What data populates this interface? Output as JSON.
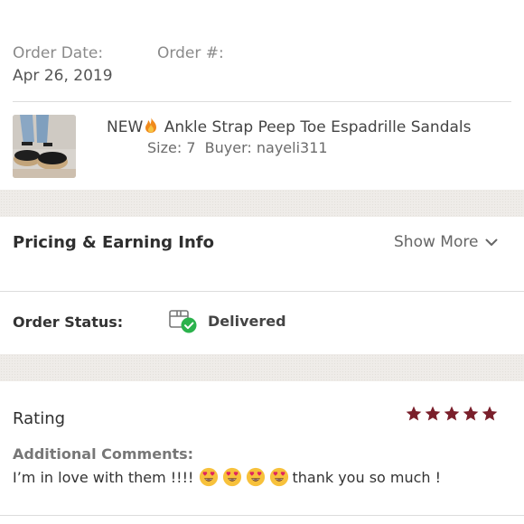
{
  "order": {
    "date_label": "Order Date:",
    "date_value": "Apr 26, 2019",
    "number_label": "Order #:",
    "number_value": ""
  },
  "product": {
    "title_prefix": "NEW",
    "title_icon": "fire-emoji",
    "title": "Ankle Strap Peep Toe Espadrille Sandals",
    "size": "Size: 7",
    "buyer": "Buyer: nayeli311",
    "thumbnail_icon": "sandal-product-photo"
  },
  "pricing": {
    "title": "Pricing & Earning Info",
    "show_more": "Show More",
    "show_more_icon": "chevron-down-icon"
  },
  "status": {
    "label": "Order Status:",
    "value": "Delivered",
    "icon": "package-delivered-icon",
    "check_color": "#2bb24c"
  },
  "rating": {
    "title": "Rating",
    "stars": 5,
    "stars_max": 5,
    "star_color": "#7a1f2b",
    "comments_label": "Additional Comments:",
    "comment_start": "I’m in love with them !!!!",
    "comment_emoji": "heart-eyes-emoji",
    "comment_emoji_count": 4,
    "comment_end": "thank you so much !"
  },
  "colors": {
    "background": "#ffffff",
    "section_gap": "#efece9",
    "divider": "#dcdcdc"
  }
}
